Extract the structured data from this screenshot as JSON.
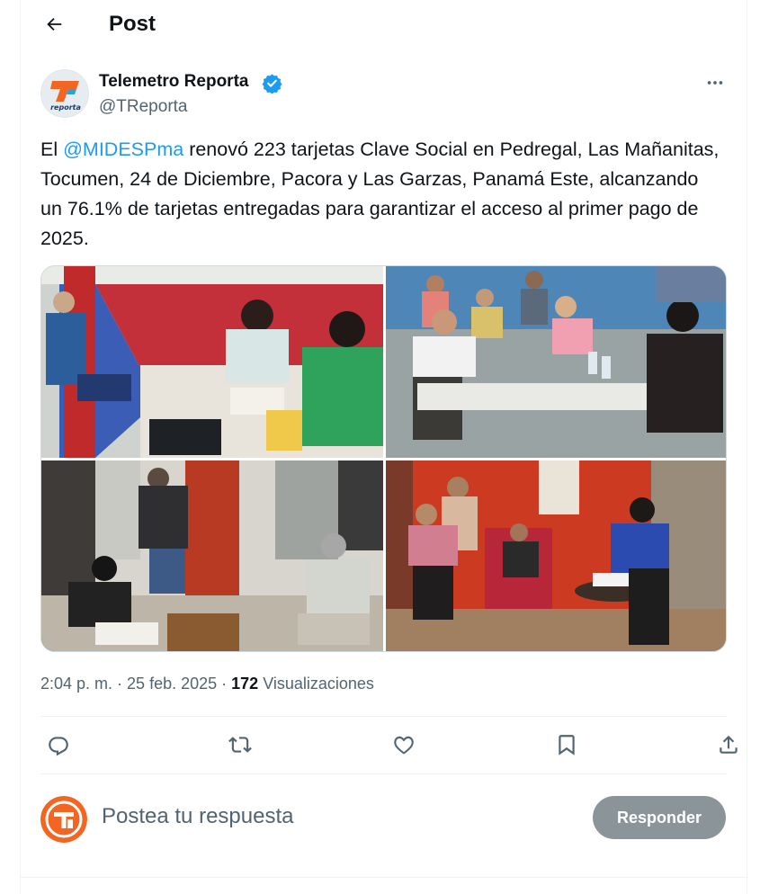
{
  "header": {
    "title": "Post"
  },
  "author": {
    "name": "Telemetro Reporta",
    "handle": "@TReporta",
    "logo_text": "reporta",
    "logo_letter": "T"
  },
  "tweet": {
    "text_before_mention": "El ",
    "mention": "@MIDESPma",
    "text_after_mention": " renovó 223 tarjetas Clave Social en Pedregal, Las Mañanitas, Tocumen, 24 de Diciembre, Pacora y Las Garzas, Panamá Este, alcanzando un 76.1% de tarjetas entregadas para garantizar el acceso al primer pago de 2025."
  },
  "meta": {
    "time": "2:04 p. m.",
    "separator1": " · ",
    "date": "25 feb. 2025",
    "separator2": " · ",
    "views": "172",
    "views_label": " Visualizaciones"
  },
  "actions": [
    "reply-icon",
    "retweet-icon",
    "like-icon",
    "bookmark-icon",
    "share-icon"
  ],
  "reply_box": {
    "placeholder": "Postea tu respuesta",
    "button_label": "Responder"
  },
  "colors": {
    "accent": "#1d9bf0",
    "text": "#0f1419",
    "secondary": "#536471",
    "reply_button": "#8b9499",
    "logo_orange": "#f26522"
  }
}
